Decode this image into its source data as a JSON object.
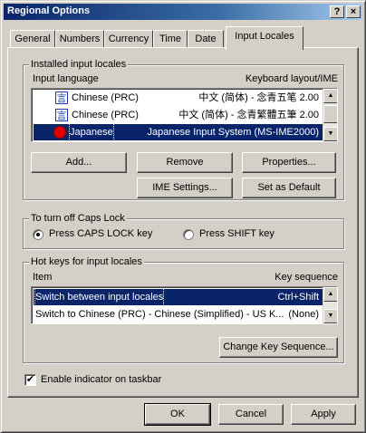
{
  "window": {
    "title": "Regional Options",
    "help_label": "?",
    "close_label": "×"
  },
  "tabs": [
    "General",
    "Numbers",
    "Currency",
    "Time",
    "Date",
    "Input Locales"
  ],
  "installed": {
    "group_label": "Installed input locales",
    "col_language": "Input language",
    "col_layout": "Keyboard layout/IME",
    "rows": [
      {
        "language": "Chinese (PRC)",
        "layout": "中文 (简体) - 念青五笔 2.00",
        "icon": "chinese-ime-icon"
      },
      {
        "language": "Chinese (PRC)",
        "layout": "中文 (简体) - 念青繁體五筆 2.00",
        "icon": "chinese-ime-icon"
      },
      {
        "language": "Japanese",
        "layout": "Japanese Input System (MS-IME2000)",
        "icon": "japanese-ime-icon",
        "selected": true
      }
    ],
    "buttons": {
      "add": "Add...",
      "remove": "Remove",
      "properties": "Properties...",
      "ime_settings": "IME Settings...",
      "set_default": "Set as Default"
    }
  },
  "caps": {
    "group_label": "To turn off Caps Lock",
    "option1": "Press CAPS LOCK key",
    "option2": "Press SHIFT key",
    "selected": "option1"
  },
  "hotkeys": {
    "group_label": "Hot keys for input locales",
    "col_item": "Item",
    "col_key": "Key sequence",
    "rows": [
      {
        "item": "Switch between input locales",
        "key": "Ctrl+Shift",
        "selected": true
      },
      {
        "item": "Switch to Chinese (PRC) - Chinese (Simplified) - US K...",
        "key": "(None)"
      }
    ],
    "change_button": "Change Key Sequence..."
  },
  "indicator": {
    "label": "Enable indicator on taskbar",
    "checked": true,
    "check_mark": "✔"
  },
  "footer": {
    "ok": "OK",
    "cancel": "Cancel",
    "apply": "Apply"
  },
  "icons": {
    "chinese_glyph": "言",
    "scroll_up": "▲",
    "scroll_down": "▼"
  }
}
